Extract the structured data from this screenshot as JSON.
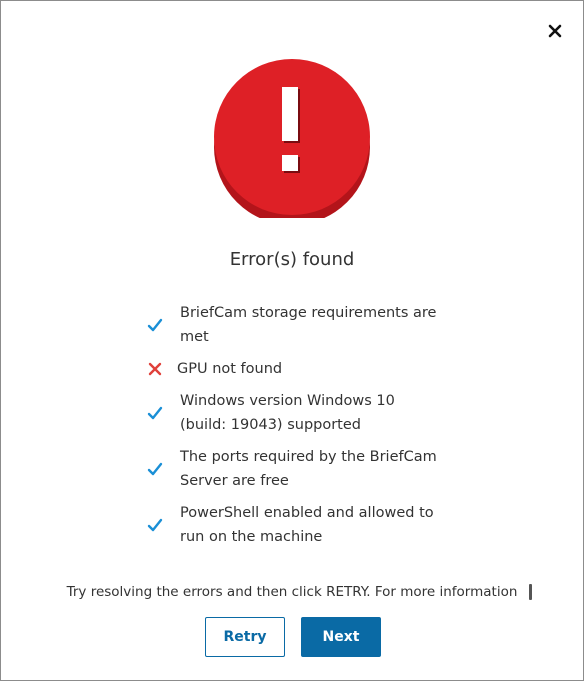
{
  "dialog": {
    "title": "Error(s) found",
    "status_icon": "error-exclamation-icon",
    "close_icon": "close-icon",
    "colors": {
      "error_red": "#d81f26",
      "check_blue": "#1a8fd6",
      "fail_red": "#e0403a",
      "accent": "#0a6aa5"
    }
  },
  "checks": [
    {
      "status": "pass",
      "text": "BriefCam storage requirements are met"
    },
    {
      "status": "fail",
      "text": "GPU not found"
    },
    {
      "status": "pass",
      "text": "Windows version Windows 10 (build: 19043) supported"
    },
    {
      "status": "pass",
      "text": "The ports required by the BriefCam Server are free"
    },
    {
      "status": "pass",
      "text": "PowerShell enabled and allowed to run on the machine"
    }
  ],
  "info_text": "Try resolving the errors and then click RETRY. For more information",
  "buttons": {
    "retry_label": "Retry",
    "next_label": "Next"
  }
}
